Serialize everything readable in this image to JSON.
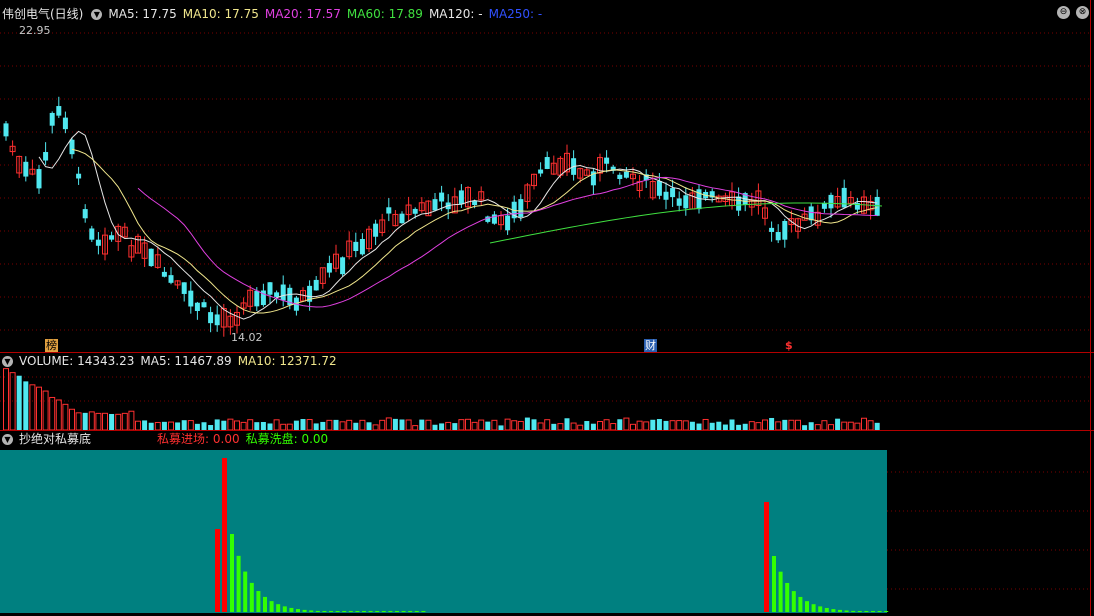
{
  "window": {
    "title": "伟创电气(日线)",
    "buttons": {
      "minimize": "⊖",
      "close": "⊗"
    }
  },
  "price_panel": {
    "indicators": [
      {
        "key": "ma5",
        "text": "MA5: 17.75",
        "color": "#e6e6e6"
      },
      {
        "key": "ma10",
        "text": "MA10: 17.75",
        "color": "#f0e68c"
      },
      {
        "key": "ma20",
        "text": "MA20: 17.57",
        "color": "#e040e0"
      },
      {
        "key": "ma60",
        "text": "MA60: 17.89",
        "color": "#40e040"
      },
      {
        "key": "ma120",
        "text": "MA120: -",
        "color": "#e6e6e6"
      },
      {
        "key": "ma250",
        "text": "MA250: -",
        "color": "#3050ff"
      }
    ],
    "high_label": "22.95",
    "low_label": "14.02",
    "markers": {
      "bang": "榜",
      "cai": "财",
      "dollar": "$"
    },
    "colors": {
      "up": "#ff3030",
      "down": "#50e8f0",
      "ma5": "#e6e6e6",
      "ma10": "#f0e68c",
      "ma20": "#e040e0",
      "ma60": "#40e040"
    }
  },
  "volume_panel": {
    "label": "VOLUME: 14343.23",
    "ma5": "MA5: 11467.89",
    "ma10": "MA10: 12371.72"
  },
  "indicator_panel": {
    "name": "抄绝对私募底",
    "entry": "私募进场: 0.00",
    "wash": "私募洗盘: 0.00",
    "colors": {
      "background": "#008080",
      "entry": "#ff0000",
      "wash": "#33ff00"
    }
  }
}
